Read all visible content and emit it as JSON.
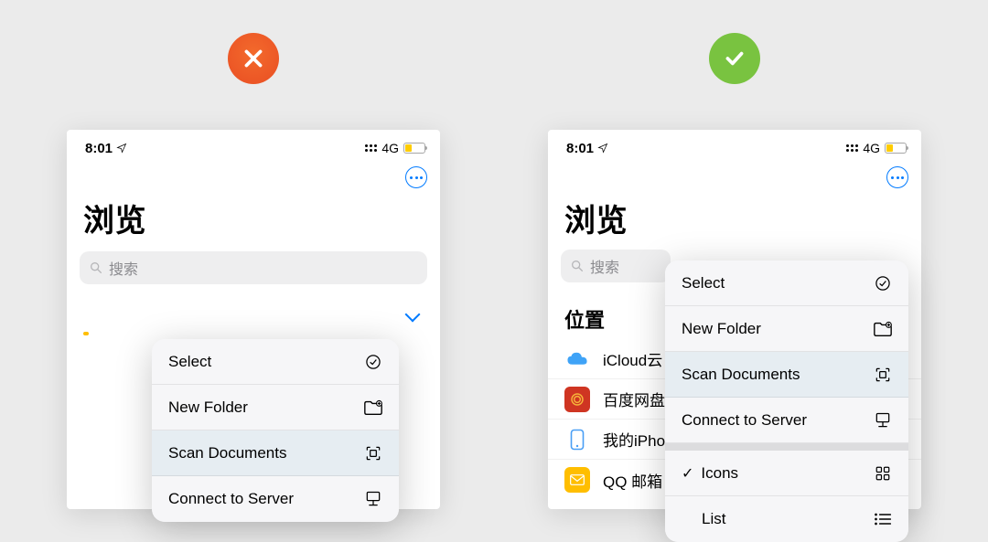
{
  "status": {
    "time": "8:01",
    "network": "4G"
  },
  "toolbar": {
    "more_label": "More"
  },
  "page": {
    "title": "浏览"
  },
  "search": {
    "placeholder": "搜索"
  },
  "section": {
    "locations": "位置"
  },
  "locations": [
    {
      "label": "iCloud云"
    },
    {
      "label": "百度网盘"
    },
    {
      "label": "我的iPhone"
    },
    {
      "label": "QQ 邮箱"
    }
  ],
  "menu": {
    "select": "Select",
    "newfolder": "New Folder",
    "scan": "Scan Documents",
    "connect": "Connect to Server",
    "icons": "Icons",
    "list": "List"
  }
}
